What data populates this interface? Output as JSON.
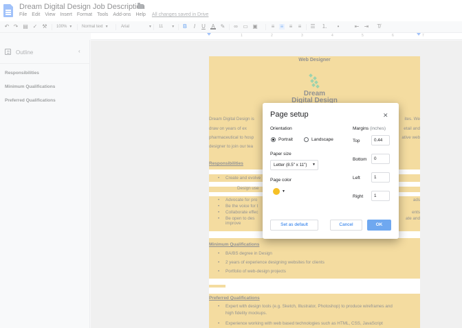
{
  "app": {
    "doc_title": "Dream Digital Design Job Description"
  },
  "menu": {
    "items": [
      "File",
      "Edit",
      "View",
      "Insert",
      "Format",
      "Tools",
      "Add-ons",
      "Help"
    ],
    "saved_status": "All changes saved in Drive"
  },
  "toolbar": {
    "zoom": "100%",
    "style": "Normal text",
    "font": "Arial",
    "size": "11"
  },
  "ruler": {
    "ticks": [
      "1",
      "2",
      "3",
      "4",
      "5",
      "6",
      "7"
    ]
  },
  "outline": {
    "title": "Outline",
    "items": [
      "Responsibilities",
      "Minimum Qualifications",
      "Preferred Qualifications"
    ]
  },
  "document": {
    "heading": "Web Designer",
    "logo_line1": "Dream",
    "logo_line2": "Digital Design",
    "intro_lines": [
      "Dream Digital Design is",
      "draw on years of ex",
      "pharmaceutical to hosp",
      "designer to join our tea"
    ],
    "intro_right": [
      "ites.  We",
      "etail  and",
      "ative  web"
    ],
    "responsibilities_heading": "Responsibilities",
    "resp_bullets": [
      "Create and evolve",
      "Advocate for pro",
      "Be the voice for t",
      "Collaborate effec",
      "Be  open  to  des",
      "improve"
    ],
    "resp_sub": "Design use",
    "resp_right": [
      "ads",
      "ents",
      "ate  and"
    ],
    "min_heading": "Minimum Qualifications",
    "min_bullets": [
      "BA/BS degree in Design",
      "2 years of experience designing websites for clients",
      "Portfolio of web-design projects"
    ],
    "pref_heading": "Preferred Qualifications",
    "pref_bullets": [
      "Expert with design tools (e.g. Sketch, Illustrator, Photoshop) to produce wireframes and",
      "high fidelity mockups.",
      "Experience working with web based technologies such as HTML, CSS, JavaScript"
    ]
  },
  "dialog": {
    "title": "Page setup",
    "orientation_label": "Orientation",
    "portrait": "Portrait",
    "landscape": "Landscape",
    "orientation_value": "Portrait",
    "paper_size_label": "Paper size",
    "paper_size_value": "Letter (8.5\" x 11\")",
    "page_color_label": "Page color",
    "page_color_value": "#f6c026",
    "margins_label": "Margins",
    "margins_unit": "(inches)",
    "top_label": "Top",
    "top_value": "0.44",
    "bottom_label": "Bottom",
    "bottom_value": "0",
    "left_label": "Left",
    "left_value": "1",
    "right_label": "Right",
    "right_value": "1",
    "set_default": "Set as default",
    "cancel": "Cancel",
    "ok": "OK"
  }
}
